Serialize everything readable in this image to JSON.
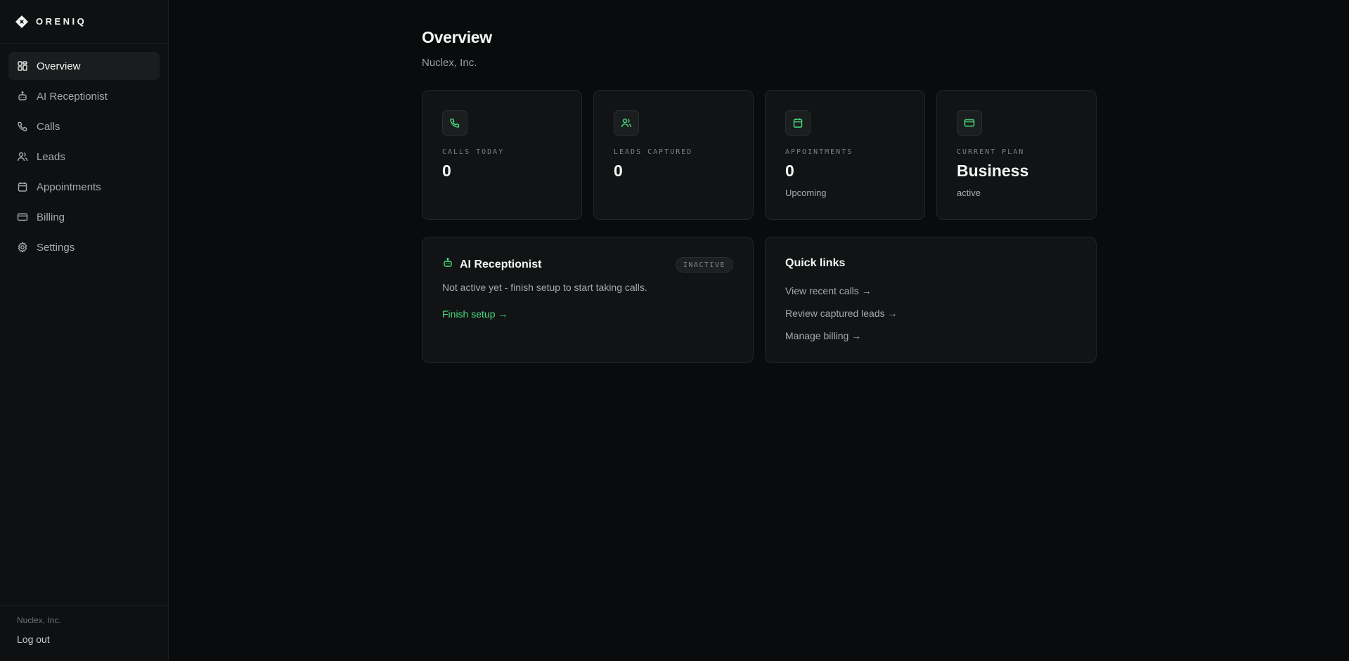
{
  "brand": {
    "name": "ORENIQ"
  },
  "sidebar": {
    "items": [
      {
        "label": "Overview",
        "icon": "grid-icon",
        "active": true
      },
      {
        "label": "AI Receptionist",
        "icon": "bot-icon"
      },
      {
        "label": "Calls",
        "icon": "phone-icon"
      },
      {
        "label": "Leads",
        "icon": "users-icon"
      },
      {
        "label": "Appointments",
        "icon": "calendar-icon"
      },
      {
        "label": "Billing",
        "icon": "credit-card-icon"
      },
      {
        "label": "Settings",
        "icon": "gear-icon"
      }
    ],
    "footer": {
      "org": "Nuclex, Inc.",
      "logout": "Log out"
    }
  },
  "page": {
    "title": "Overview",
    "subtitle": "Nuclex, Inc."
  },
  "stats": [
    {
      "icon": "phone-icon",
      "label": "CALLS TODAY",
      "value": "0",
      "note": ""
    },
    {
      "icon": "users-icon",
      "label": "LEADS CAPTURED",
      "value": "0",
      "note": ""
    },
    {
      "icon": "calendar-icon",
      "label": "APPOINTMENTS",
      "value": "0",
      "note": "Upcoming"
    },
    {
      "icon": "credit-card-icon",
      "label": "CURRENT PLAN",
      "value": "Business",
      "note": "active"
    }
  ],
  "receptionist": {
    "title": "AI Receptionist",
    "status": "INACTIVE",
    "description": "Not active yet - finish setup to start taking calls.",
    "action": "Finish setup →"
  },
  "quick_links": {
    "title": "Quick links",
    "links": [
      "View recent calls →",
      "Review captured leads →",
      "Manage billing →"
    ]
  },
  "colors": {
    "accent": "#4ade80",
    "background": "#0a0b0c",
    "card": "#111314"
  }
}
